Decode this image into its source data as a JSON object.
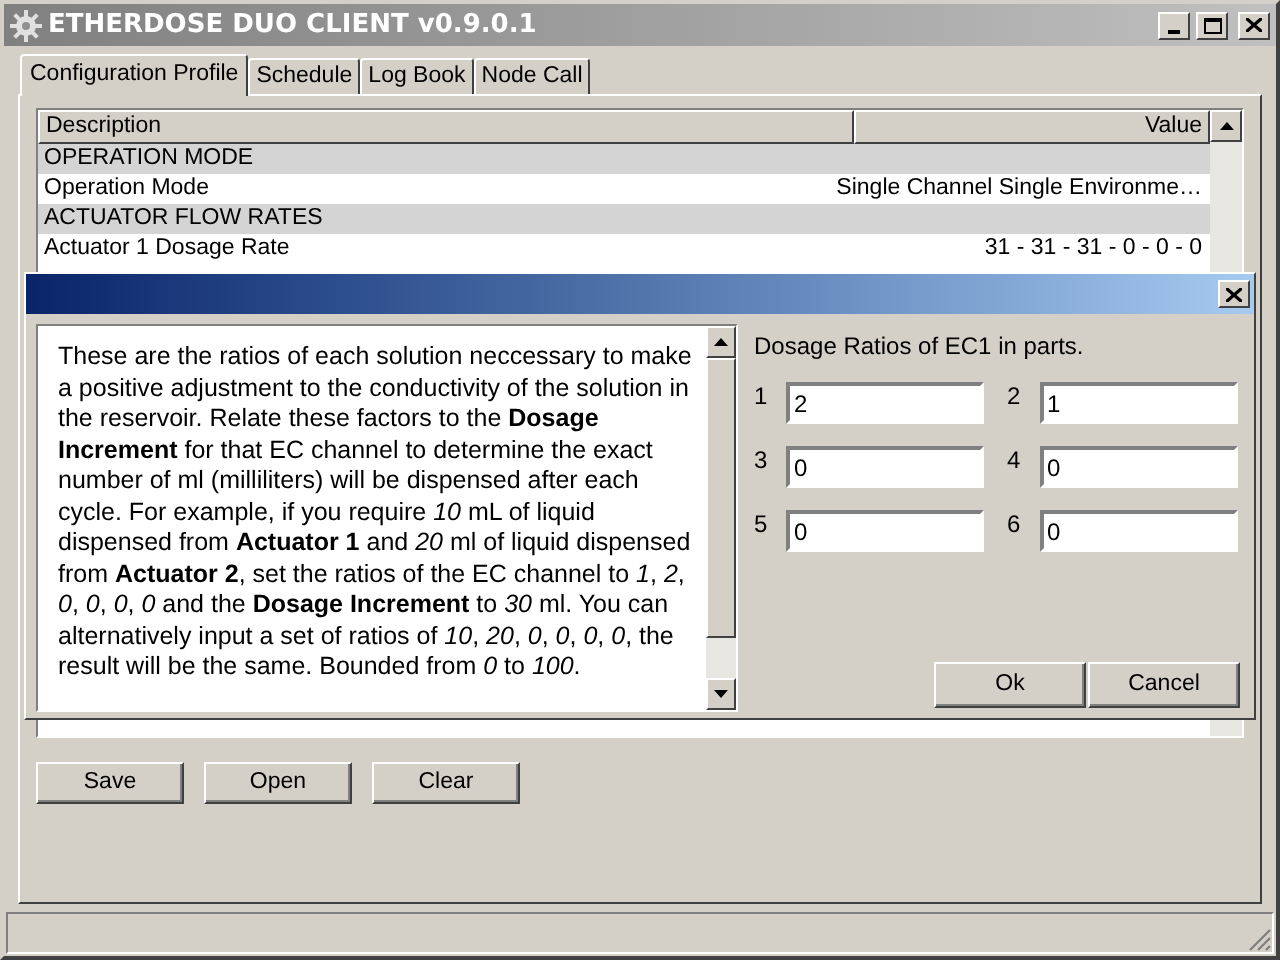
{
  "window": {
    "title": "ETHERDOSE DUO CLIENT v0.9.0.1"
  },
  "tabs": [
    {
      "label": "Configuration Profile",
      "selected": true
    },
    {
      "label": "Schedule",
      "selected": false
    },
    {
      "label": "Log Book",
      "selected": false
    },
    {
      "label": "Node Call",
      "selected": false
    }
  ],
  "table": {
    "columns": [
      "Description",
      "Value"
    ],
    "rows": [
      {
        "kind": "section",
        "description": "OPERATION MODE"
      },
      {
        "kind": "item",
        "description": "Operation Mode",
        "value": "Single Channel Single Environme…"
      },
      {
        "kind": "section",
        "description": "ACTUATOR FLOW RATES"
      },
      {
        "kind": "item",
        "description": "Actuator 1 Dosage Rate",
        "value": "31 - 31 - 31 - 0 - 0 - 0"
      }
    ]
  },
  "buttons": [
    "Save",
    "Open",
    "Clear"
  ],
  "dialog": {
    "help_text": "These are the ratios of each solution neccessary to make a positive adjustment to the conductivity of the solution in the reservoir. Relate these factors to the **Dosage Increment** for that EC channel to determine the exact number of ml (milliliters) will be dispensed after each cycle. For example, if you require *10* mL of liquid dispensed from **Actuator 1** and *20* ml of liquid dispensed from **Actuator 2**, set the ratios of the EC channel to *1*, *2*, *0*, *0*, *0*, *0* and the **Dosage Increment** to *30* ml. You can alternatively input a set of ratios of *10*, *20*, *0*, *0*, *0*, *0*, the result will be the same. Bounded from *0* to *100*.",
    "heading": "Dosage Ratios of EC1 in parts.",
    "fields": [
      {
        "label": "1",
        "value": "2"
      },
      {
        "label": "2",
        "value": "1"
      },
      {
        "label": "3",
        "value": "0"
      },
      {
        "label": "4",
        "value": "0"
      },
      {
        "label": "5",
        "value": "0"
      },
      {
        "label": "6",
        "value": "0"
      }
    ],
    "buttons": [
      "Ok",
      "Cancel"
    ]
  }
}
